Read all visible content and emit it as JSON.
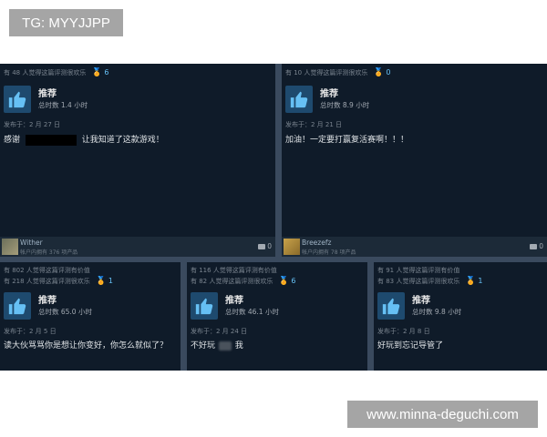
{
  "watermarks": {
    "top_left": "TG: MYYJJPP",
    "bottom_right": "www.minna-deguchi.com"
  },
  "reviews": [
    {
      "helpful_lines": [],
      "funny_line": "有 48 人觉得这篇评测很欢乐",
      "award_count": "6",
      "recommend": "推荐",
      "hours": "总时数 1.4 小时",
      "posted": "发布于：2 月 27 日",
      "text_before": "感谢",
      "text_after": "让我知道了这款游戏！",
      "author_name": "Wither",
      "author_meta": "帐户内拥有 376 项产品",
      "comment_count": "0"
    },
    {
      "helpful_lines": [],
      "funny_line": "有 10 人觉得这篇评测很欢乐",
      "award_count": "0",
      "recommend": "推荐",
      "hours": "总时数 8.9 小时",
      "posted": "发布于：2 月 21 日",
      "text": "加油！一定要打赢复活赛啊！！！",
      "author_name": "Breezefz",
      "author_meta": "帐户内拥有 78 项产品",
      "comment_count": "0"
    },
    {
      "helpful_line": "有 802 人觉得这篇评测有价值",
      "funny_line": "有 218 人觉得这篇评测很欢乐",
      "award_count": "1",
      "recommend": "推荐",
      "hours": "总时数 65.0 小时",
      "posted": "发布于：2 月 5 日",
      "text": "读大伙骂骂你是想让你变好，你怎么就似了？"
    },
    {
      "helpful_line": "有 116 人觉得这篇评测有价值",
      "funny_line": "有 82 人觉得这篇评测很欢乐",
      "award_count": "6",
      "recommend": "推荐",
      "hours": "总时数 46.1 小时",
      "posted": "发布于：2 月 24 日",
      "text_before": "不好玩",
      "text_after": "我"
    },
    {
      "helpful_line": "有 91 人觉得这篇评测有价值",
      "funny_line": "有 83 人觉得这篇评测很欢乐",
      "award_count": "1",
      "recommend": "推荐",
      "hours": "总时数 9.8 小时",
      "posted": "发布于：2 月 8 日",
      "text": "好玩到忘记导管了"
    }
  ],
  "colors": {
    "card_bg": "#0f1b29",
    "accent": "#66c0f4",
    "thumb_bg": "#1e4a6e"
  }
}
